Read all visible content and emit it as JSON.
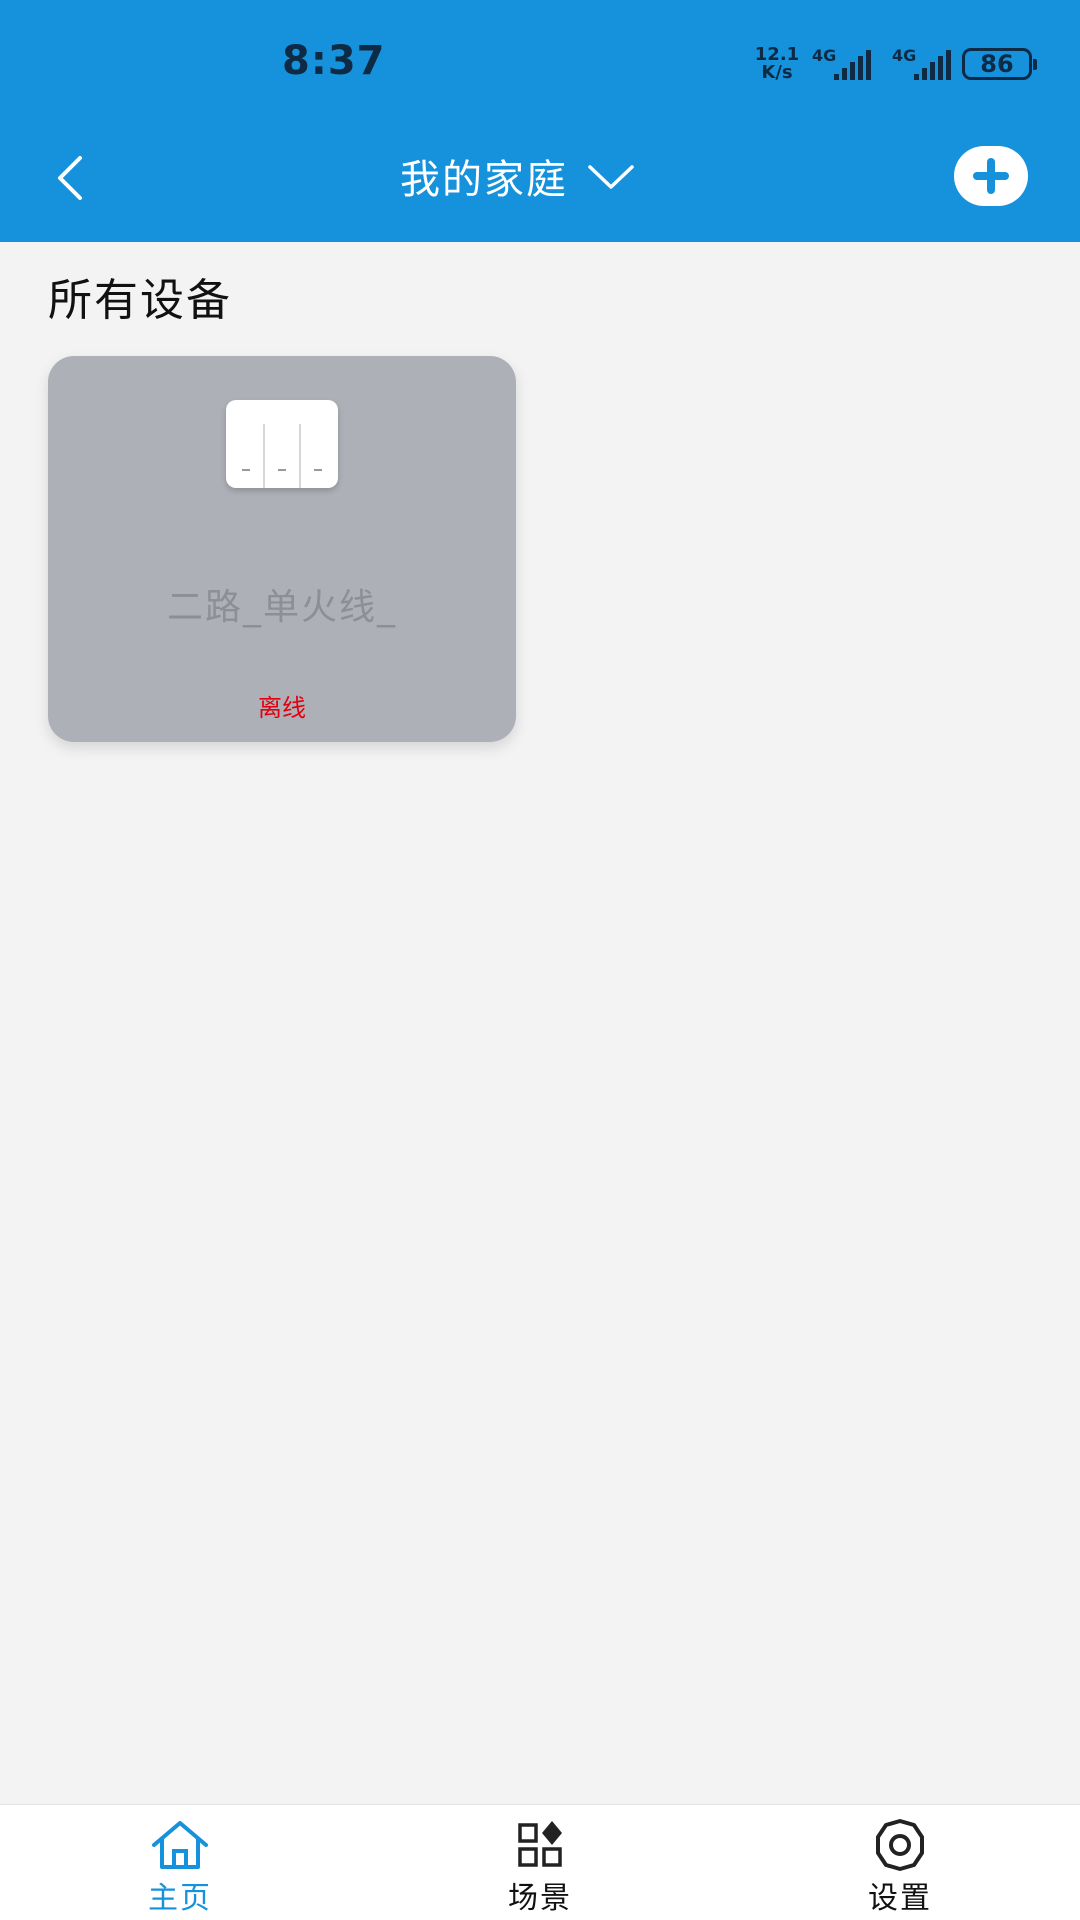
{
  "status_bar": {
    "time": "8:37",
    "net_speed_value": "12.1",
    "net_speed_unit": "K/s",
    "signal_1_label": "4G",
    "signal_2_label": "4G",
    "battery": "86"
  },
  "app_bar": {
    "title": "我的家庭",
    "back_icon": "chevron-left-icon",
    "dropdown_icon": "chevron-down-icon",
    "add_icon": "plus-icon"
  },
  "main": {
    "section_title": "所有设备",
    "devices": [
      {
        "name": "二路_单火线_",
        "status": "离线",
        "icon": "wall-switch-icon"
      }
    ]
  },
  "tab_bar": {
    "tabs": [
      {
        "label": "主页",
        "icon": "home-icon",
        "active": true
      },
      {
        "label": "场景",
        "icon": "scene-grid-icon",
        "active": false
      },
      {
        "label": "设置",
        "icon": "gear-icon",
        "active": false
      }
    ]
  },
  "colors": {
    "primary": "#1592db",
    "background": "#f3f3f4",
    "offline_card": "#adb1b7",
    "offline_status": "#e3000f"
  }
}
